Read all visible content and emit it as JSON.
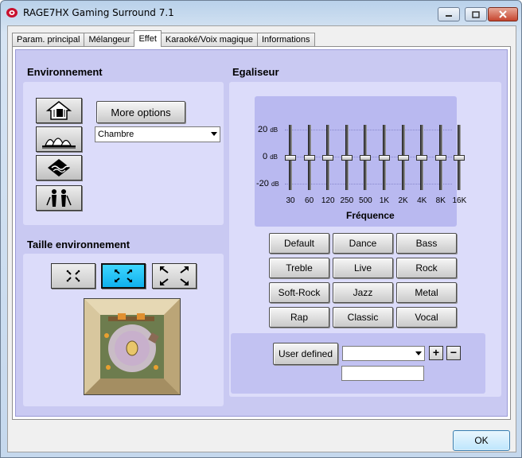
{
  "window": {
    "title": "RAGE7HX Gaming Surround 7.1"
  },
  "tabs": [
    {
      "label": "Param. principal"
    },
    {
      "label": "Mélangeur"
    },
    {
      "label": "Effet"
    },
    {
      "label": "Karaoké/Voix magique"
    },
    {
      "label": "Informations"
    }
  ],
  "active_tab": "Effet",
  "environment": {
    "title": "Environnement",
    "more_options_label": "More options",
    "selected": "Chambre",
    "icons": [
      "house-icon",
      "opera-house-icon",
      "underwater-icon",
      "outdoor-people-icon"
    ]
  },
  "room_size": {
    "title": "Taille environnement",
    "options": [
      "small-room-icon",
      "medium-room-icon",
      "large-room-icon"
    ],
    "selected_index": 1
  },
  "equalizer": {
    "title": "Egaliseur",
    "db_labels": [
      {
        "value": "20",
        "unit": "dB"
      },
      {
        "value": "0",
        "unit": "dB"
      },
      {
        "value": "-20",
        "unit": "dB"
      }
    ],
    "frequencies": [
      "30",
      "60",
      "120",
      "250",
      "500",
      "1K",
      "2K",
      "4K",
      "8K",
      "16K"
    ],
    "gains_db": [
      0,
      0,
      0,
      0,
      0,
      0,
      0,
      0,
      0,
      0
    ],
    "axis_title": "Fréquence",
    "presets": [
      "Default",
      "Dance",
      "Bass",
      "Treble",
      "Live",
      "Rock",
      "Soft-Rock",
      "Jazz",
      "Metal",
      "Rap",
      "Classic",
      "Vocal"
    ],
    "user_defined_label": "User defined",
    "user_select_value": "",
    "user_name_value": "",
    "add_label": "+",
    "remove_label": "−"
  },
  "footer": {
    "ok_label": "OK"
  },
  "colors": {
    "accent": "#1fc3f7",
    "panel": "#c9c9f2",
    "group": "#dcdcfa"
  }
}
